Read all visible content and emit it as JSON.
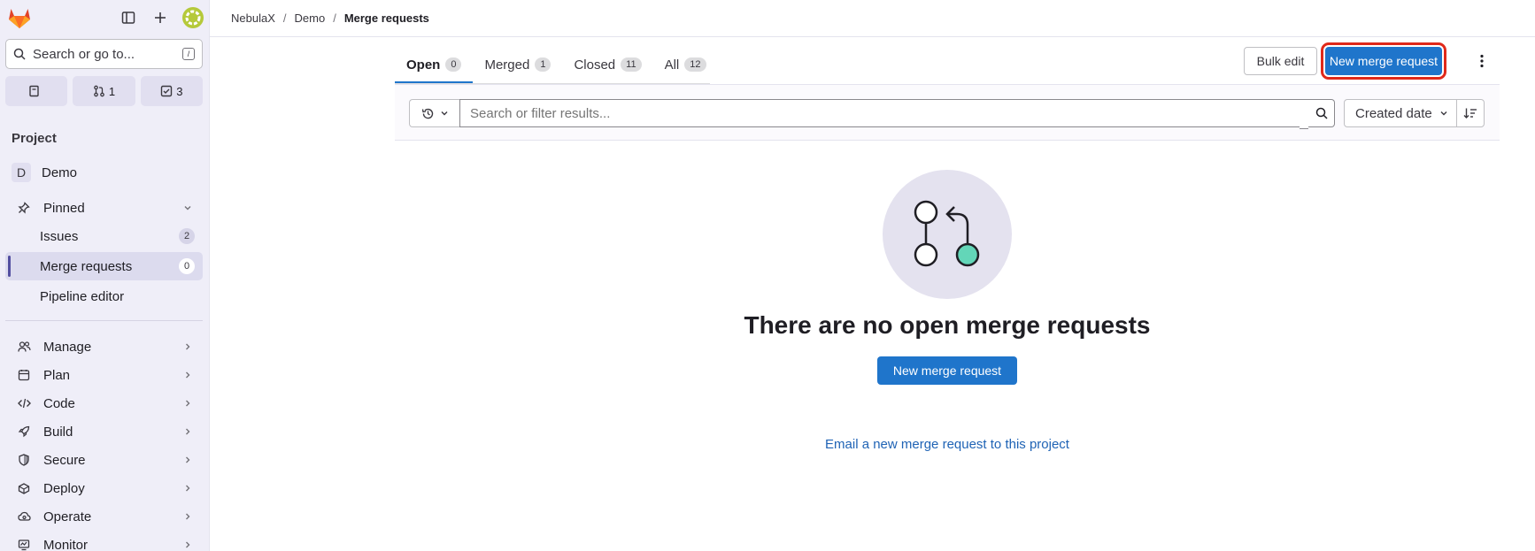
{
  "colors": {
    "accent": "#1f75cb",
    "sidebar_bg": "#efeef8",
    "highlight": "#e0291a"
  },
  "sidebar": {
    "search_label": "Search or go to...",
    "search_shortcut": "/",
    "counters": [
      {
        "icon": "issues-icon",
        "value": ""
      },
      {
        "icon": "merge-request-icon",
        "value": "1"
      },
      {
        "icon": "todo-icon",
        "value": "3"
      }
    ],
    "section_title": "Project",
    "project_initial": "D",
    "project_name": "Demo",
    "pinned_label": "Pinned",
    "pinned_items": [
      {
        "label": "Issues",
        "badge": "2"
      },
      {
        "label": "Merge requests",
        "badge": "0"
      },
      {
        "label": "Pipeline editor",
        "badge": ""
      }
    ],
    "nav": [
      {
        "label": "Manage"
      },
      {
        "label": "Plan"
      },
      {
        "label": "Code"
      },
      {
        "label": "Build"
      },
      {
        "label": "Secure"
      },
      {
        "label": "Deploy"
      },
      {
        "label": "Operate"
      },
      {
        "label": "Monitor"
      }
    ]
  },
  "breadcrumb": [
    "NebulaX",
    "Demo",
    "Merge requests"
  ],
  "tabs": [
    {
      "label": "Open",
      "count": "0"
    },
    {
      "label": "Merged",
      "count": "1"
    },
    {
      "label": "Closed",
      "count": "11"
    },
    {
      "label": "All",
      "count": "12"
    }
  ],
  "actions": {
    "bulk_edit": "Bulk edit",
    "new_mr": "New merge request"
  },
  "filter": {
    "placeholder": "Search or filter results...",
    "sort_label": "Created date"
  },
  "empty": {
    "title": "There are no open merge requests",
    "button": "New merge request",
    "email_link": "Email a new merge request to this project"
  }
}
